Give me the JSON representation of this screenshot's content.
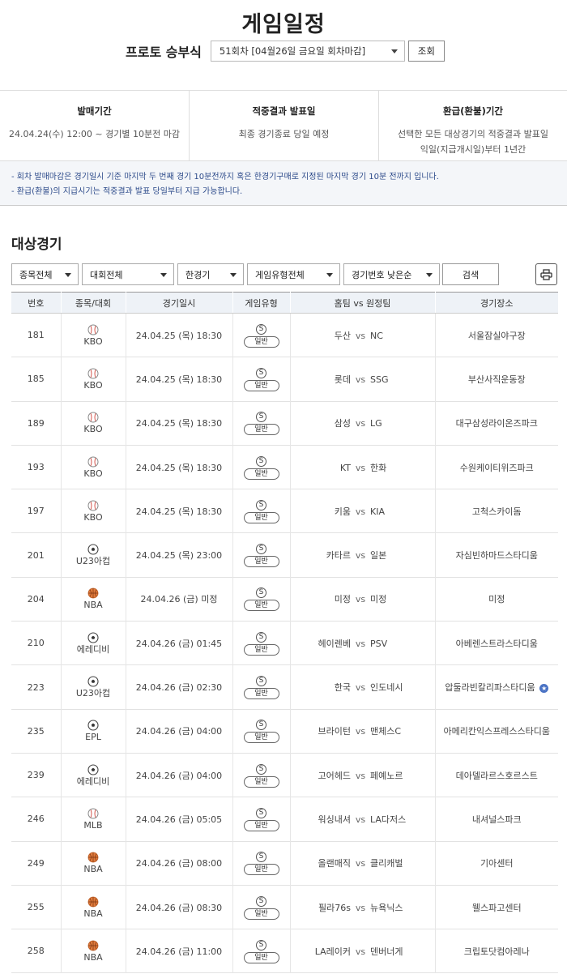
{
  "page": {
    "title": "게임일정"
  },
  "round": {
    "label": "프로토 승부식",
    "selected": "51회차 [04월26일 금요일 회차마감]",
    "view_button": "조회"
  },
  "info": [
    {
      "head": "발매기간",
      "lines": [
        "24.04.24(수) 12:00 ~ 경기별 10분전 마감"
      ]
    },
    {
      "head": "적중결과 발표일",
      "lines": [
        "최종 경기종료 당일 예정"
      ]
    },
    {
      "head": "환급(환불)기간",
      "lines": [
        "선택한 모든 대상경기의 적중결과 발표일",
        "익일(지급개시일)부터 1년간"
      ]
    }
  ],
  "notice": [
    "- 회차 발매마감은 경기일시 기준 마지막 두 번째 경기 10분전까지 혹은 한경기구매로 지정된 마지막 경기 10분 전까지 입니다.",
    "- 환급(환불)의 지급시기는 적중결과 발표 당일부터 지급 가능합니다."
  ],
  "section_title": "대상경기",
  "filters": {
    "sport": "종목전체",
    "league": "대회전체",
    "match_mode": "한경기",
    "game_type": "게임유형전체",
    "sort": "경기번호 낮은순",
    "search_button": "검색"
  },
  "table": {
    "headers": [
      "번호",
      "종목/대회",
      "경기일시",
      "게임유형",
      "홈팀 vs 원정팀",
      "경기장소"
    ],
    "type_symbol": "S",
    "type_label": "일반",
    "vs": "vs",
    "rows": [
      {
        "no": "181",
        "sport": "baseball",
        "league": "KBO",
        "datetime": "24.04.25 (목) 18:30",
        "home": "두산",
        "away": "NC",
        "venue": "서울잠실야구장"
      },
      {
        "no": "185",
        "sport": "baseball",
        "league": "KBO",
        "datetime": "24.04.25 (목) 18:30",
        "home": "롯데",
        "away": "SSG",
        "venue": "부산사직운동장"
      },
      {
        "no": "189",
        "sport": "baseball",
        "league": "KBO",
        "datetime": "24.04.25 (목) 18:30",
        "home": "삼성",
        "away": "LG",
        "venue": "대구삼성라이온즈파크"
      },
      {
        "no": "193",
        "sport": "baseball",
        "league": "KBO",
        "datetime": "24.04.25 (목) 18:30",
        "home": "KT",
        "away": "한화",
        "venue": "수원케이티위즈파크"
      },
      {
        "no": "197",
        "sport": "baseball",
        "league": "KBO",
        "datetime": "24.04.25 (목) 18:30",
        "home": "키움",
        "away": "KIA",
        "venue": "고척스카이돔"
      },
      {
        "no": "201",
        "sport": "soccer",
        "league": "U23아컵",
        "datetime": "24.04.25 (목) 23:00",
        "home": "카타르",
        "away": "일본",
        "venue": "자심빈하마드스타디움"
      },
      {
        "no": "204",
        "sport": "basketball",
        "league": "NBA",
        "datetime": "24.04.26 (금) 미정",
        "home": "미정",
        "away": "미정",
        "venue": "미정"
      },
      {
        "no": "210",
        "sport": "soccer",
        "league": "에레디비",
        "datetime": "24.04.26 (금) 01:45",
        "home": "헤이렌베",
        "away": "PSV",
        "venue": "아베렌스트라스타디움"
      },
      {
        "no": "223",
        "sport": "soccer",
        "league": "U23아컵",
        "datetime": "24.04.26 (금) 02:30",
        "home": "한국",
        "away": "인도네시",
        "venue": "압둘라빈칼리파스타디움",
        "venue_mark": "★"
      },
      {
        "no": "235",
        "sport": "soccer",
        "league": "EPL",
        "datetime": "24.04.26 (금) 04:00",
        "home": "브라이턴",
        "away": "맨체스C",
        "venue": "아메리칸익스프레스스타디움"
      },
      {
        "no": "239",
        "sport": "soccer",
        "league": "에레디비",
        "datetime": "24.04.26 (금) 04:00",
        "home": "고어헤드",
        "away": "페예노르",
        "venue": "데아델라르스호르스트"
      },
      {
        "no": "246",
        "sport": "baseball",
        "league": "MLB",
        "datetime": "24.04.26 (금) 05:05",
        "home": "워싱내셔",
        "away": "LA다저스",
        "venue": "내셔널스파크"
      },
      {
        "no": "249",
        "sport": "basketball",
        "league": "NBA",
        "datetime": "24.04.26 (금) 08:00",
        "home": "올랜매직",
        "away": "클리캐벌",
        "venue": "기아센터"
      },
      {
        "no": "255",
        "sport": "basketball",
        "league": "NBA",
        "datetime": "24.04.26 (금) 08:30",
        "home": "필라76s",
        "away": "뉴욕닉스",
        "venue": "웰스파고센터"
      },
      {
        "no": "258",
        "sport": "basketball",
        "league": "NBA",
        "datetime": "24.04.26 (금) 11:00",
        "home": "LA레이커",
        "away": "덴버너게",
        "venue": "크립토닷컴아레나"
      }
    ]
  },
  "icons": {
    "baseball": "baseball-icon",
    "soccer": "soccer-ball-icon",
    "basketball": "basketball-icon",
    "print": "printer-icon"
  },
  "colors": {
    "notice_text": "#2c4a8a",
    "header_bg": "#eef2f7",
    "basketball": "#e07a3c",
    "baseball_stitch": "#d0453c",
    "venue_star": "#4a72c4"
  }
}
